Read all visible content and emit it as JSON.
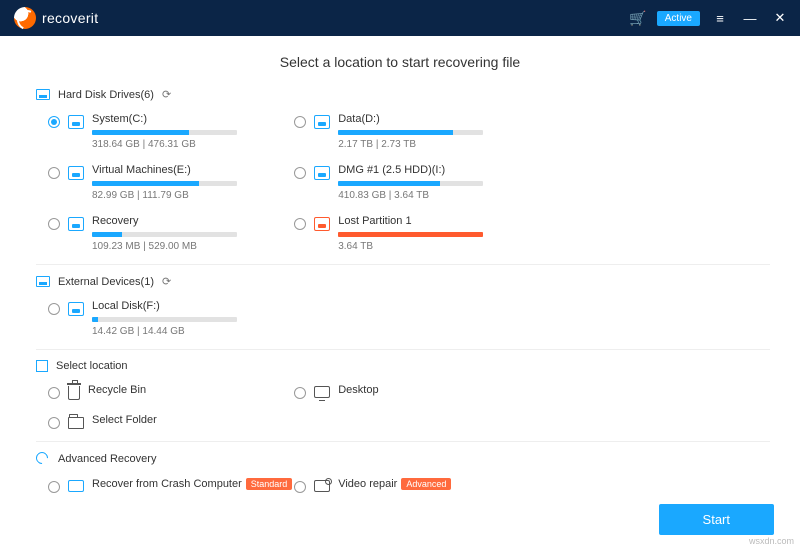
{
  "brand": "recoverit",
  "header": {
    "active_badge": "Active"
  },
  "page_title": "Select a location to start recovering file",
  "sections": {
    "hdd": {
      "title": "Hard Disk Drives(6)",
      "drives": [
        {
          "label": "System(C:)",
          "stats": "318.64 GB | 476.31 GB",
          "pct": 67,
          "selected": true
        },
        {
          "label": "Data(D:)",
          "stats": "2.17 TB | 2.73 TB",
          "pct": 79,
          "selected": false
        },
        {
          "label": "Virtual Machines(E:)",
          "stats": "82.99 GB | 111.79 GB",
          "pct": 74,
          "selected": false
        },
        {
          "label": "DMG #1 (2.5 HDD)(I:)",
          "stats": "410.83 GB | 3.64 TB",
          "pct": 70,
          "selected": false
        },
        {
          "label": "Recovery",
          "stats": "109.23 MB | 529.00 MB",
          "pct": 21,
          "selected": false
        },
        {
          "label": "Lost Partition 1",
          "stats": "3.64 TB",
          "pct": 100,
          "selected": false,
          "lost": true
        }
      ]
    },
    "ext": {
      "title": "External Devices(1)",
      "drives": [
        {
          "label": "Local Disk(F:)",
          "stats": "14.42 GB | 14.44 GB",
          "pct": 4,
          "selected": false
        }
      ]
    },
    "loc": {
      "title": "Select location",
      "items": [
        {
          "label": "Recycle Bin",
          "icon": "bin"
        },
        {
          "label": "Desktop",
          "icon": "desktop"
        },
        {
          "label": "Select Folder",
          "icon": "folder"
        }
      ]
    },
    "adv": {
      "title": "Advanced Recovery",
      "items": [
        {
          "label": "Recover from Crash Computer",
          "badge": "Standard",
          "icon": "crash"
        },
        {
          "label": "Video repair",
          "badge": "Advanced",
          "icon": "video"
        }
      ]
    }
  },
  "start_label": "Start",
  "watermark": "wsxdn.com"
}
